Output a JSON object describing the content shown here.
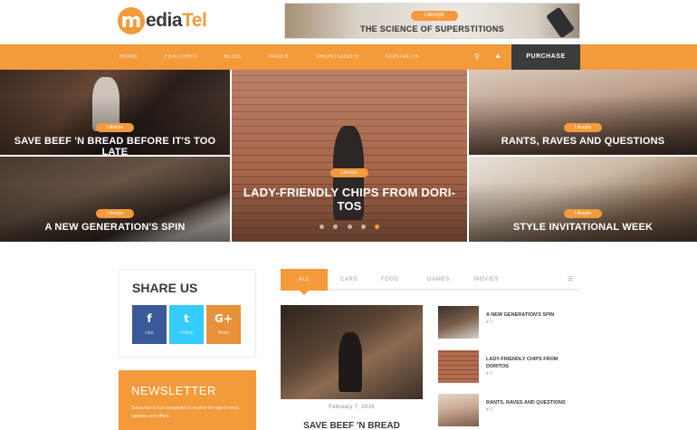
{
  "logo": {
    "letter": "m",
    "text_a": "edia",
    "text_b": "Tel"
  },
  "banner": {
    "badge": "Lifestyle",
    "title": "THE SCIENCE OF SUPERSTITIONS"
  },
  "nav": {
    "items": [
      "Home",
      "Features",
      "Blog",
      "Pages",
      "Shortcodes",
      "Contacts"
    ],
    "purchase_label": "PURCHASE"
  },
  "hero": {
    "tiles": [
      {
        "badge": "Lifestyle",
        "title": "SAVE BEEF 'N BREAD BEFORE IT'S TOO LATE"
      },
      {
        "badge": "Lifestyle",
        "title": "A NEW GENERATION'S SPIN"
      },
      {
        "badge": "Lifestyle",
        "title": "LADY-FRIENDLY CHIPS FROM DORI-TOS"
      },
      {
        "badge": "Lifestyle",
        "title": "RANTS, RAVES AND QUESTIONS"
      },
      {
        "badge": "Lifestyle",
        "title": "STYLE INVITATIONAL WEEK"
      }
    ],
    "slider_dots": 5,
    "active_dot": 4
  },
  "share": {
    "title": "SHARE US",
    "networks": [
      {
        "glyph": "f",
        "count": "Like",
        "color": "#3b5998"
      },
      {
        "glyph": "t",
        "count": "Follow",
        "color": "#33ccff"
      },
      {
        "glyph": "G+",
        "count": "Share",
        "color": "#e8913a"
      }
    ]
  },
  "newsletter": {
    "title": "NEWSLETTER",
    "text": "Subscribe to our newsletter to receive the latest news, updates and offers."
  },
  "tabs": {
    "items": [
      "All",
      "Cars",
      "Food",
      "Games",
      "Movies"
    ],
    "active": 0
  },
  "feature": {
    "date": "February 7, 2016",
    "title": "SAVE BEEF 'N BREAD"
  },
  "side_posts": [
    {
      "title": "A NEW GENERATION'S SPIN",
      "meta": "0"
    },
    {
      "title": "LADY-FRIENDLY CHIPS FROM DORITOS",
      "meta": "0"
    },
    {
      "title": "RANTS, RAVES AND QUESTIONS",
      "meta": "0"
    }
  ],
  "colors": {
    "accent": "#f39a3b",
    "dark": "#3b3b3b"
  }
}
